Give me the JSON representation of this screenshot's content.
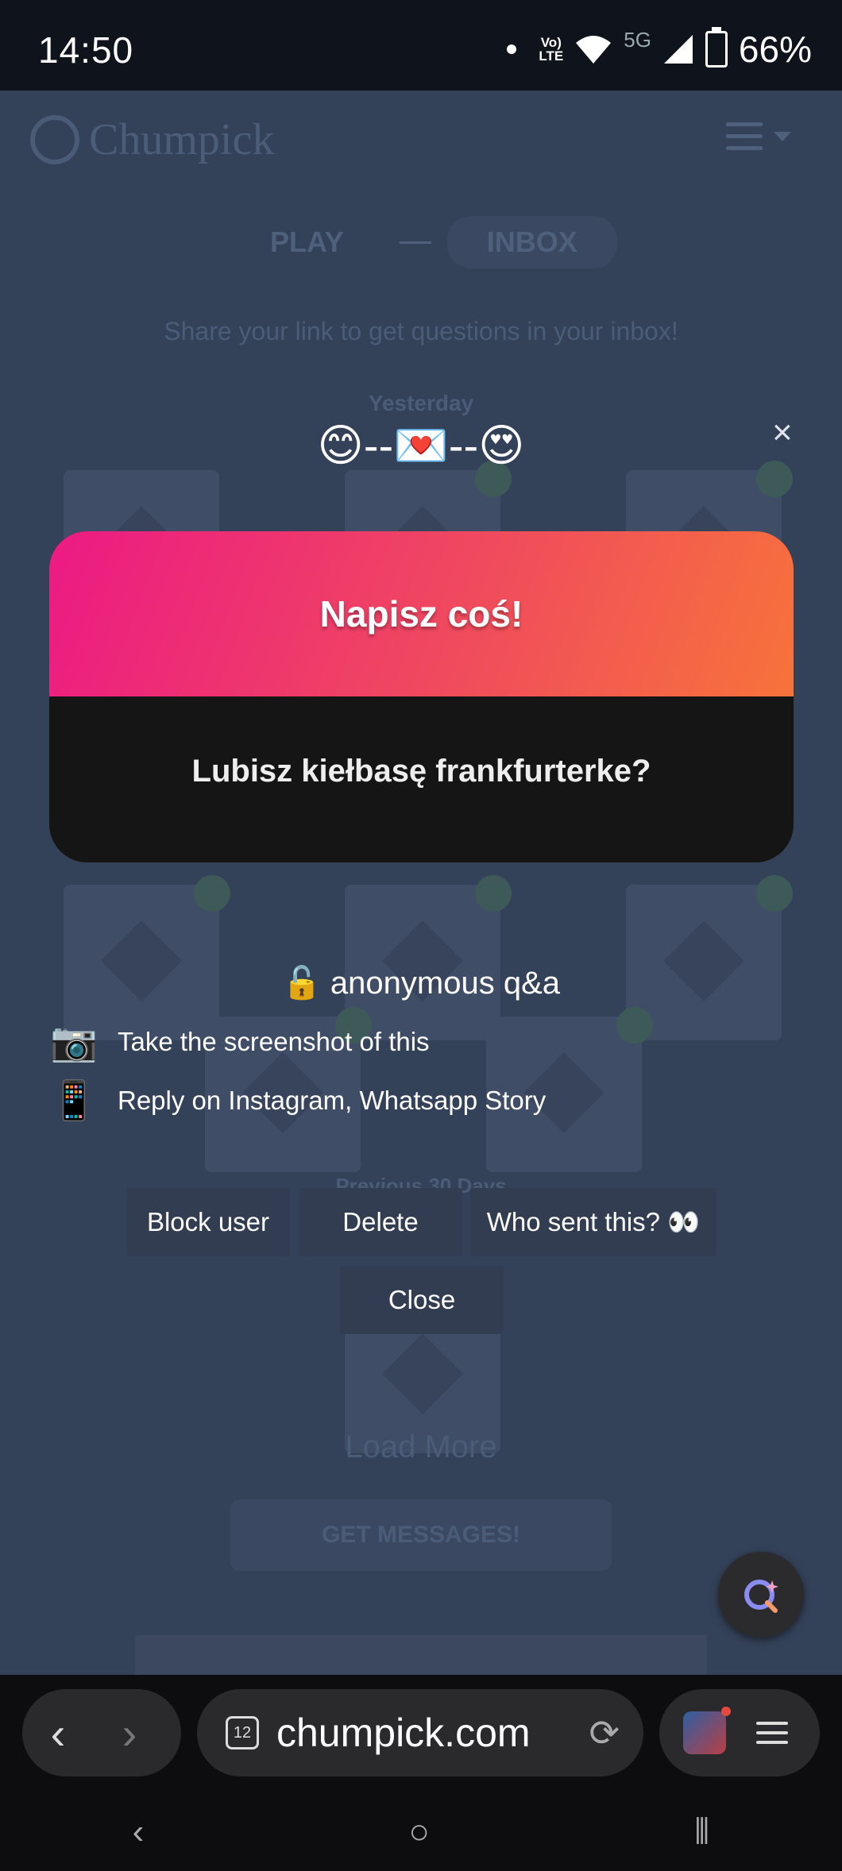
{
  "status_bar": {
    "time": "14:50",
    "network": "5G",
    "battery": "66%"
  },
  "background_page": {
    "logo": "Chumpick",
    "tabs": [
      "PLAY",
      "INBOX"
    ],
    "share_text": "Share your link to get questions in your inbox!",
    "yesterday": "Yesterday",
    "previous": "Previous 30 Days",
    "load_more": "Load More",
    "get_messages": "GET MESSAGES!"
  },
  "modal": {
    "emoji_row": "😊--💌--😍",
    "close_icon": "×",
    "card_title": "Napisz coś!",
    "question": "Lubisz kiełbasę frankfurterke?",
    "anon_line": "🔓 anonymous q&a",
    "steps": [
      {
        "icon": "📷",
        "text": "Take the screenshot of this"
      },
      {
        "icon": "📱",
        "text": "Reply on Instagram, Whatsapp Story"
      }
    ],
    "buttons": {
      "block": "Block user",
      "delete": "Delete",
      "who_sent": "Who sent this? 👀",
      "close": "Close"
    }
  },
  "browser": {
    "tab_count": "12",
    "url": "chumpick.com"
  },
  "colors": {
    "card_gradient_start": "#ec1a84",
    "card_gradient_end": "#f7733a",
    "overlay": "#3a4a62"
  }
}
